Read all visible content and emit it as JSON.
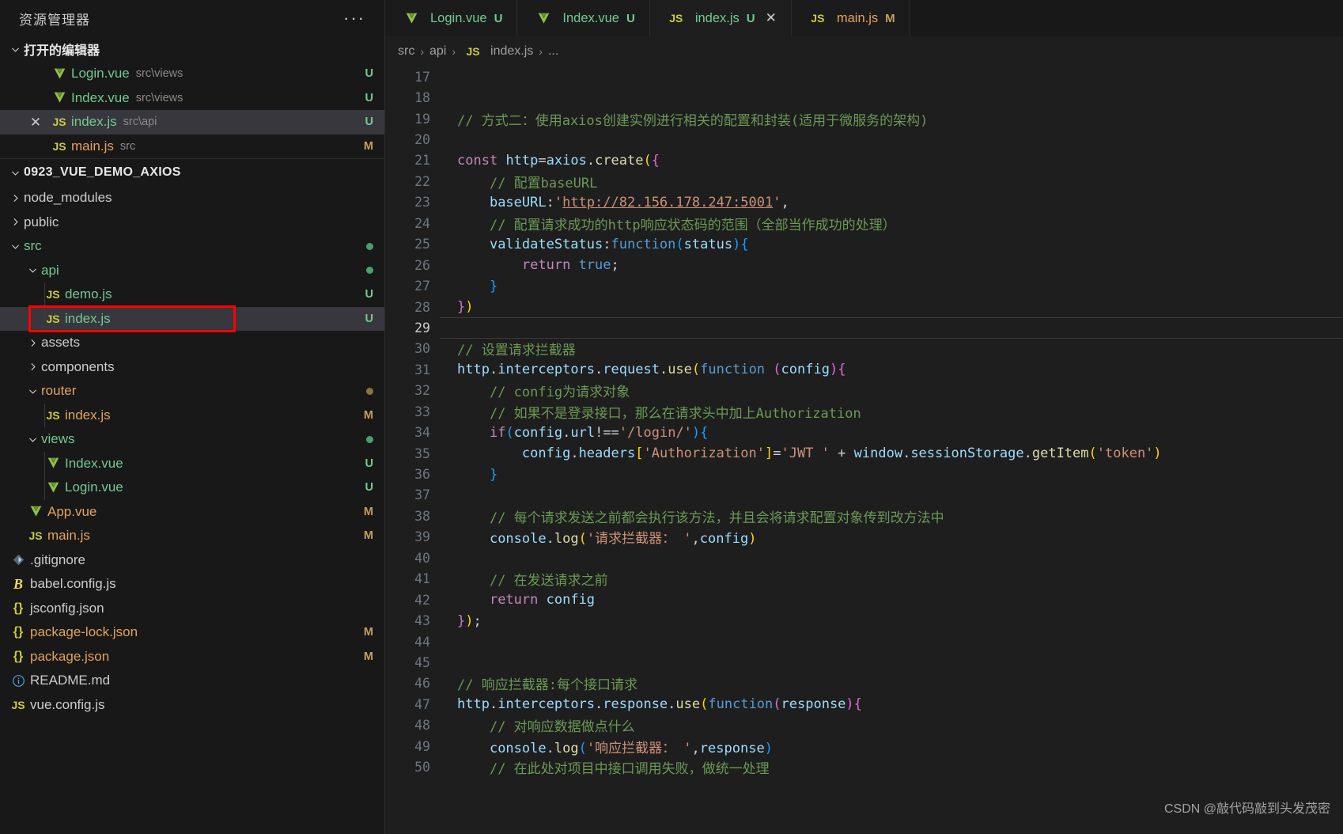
{
  "sidebar": {
    "title": "资源管理器",
    "more_label": "···",
    "open_editors": {
      "label": "打开的编辑器",
      "items": [
        {
          "icon": "vue-icon",
          "name": "Login.vue",
          "desc": "src\\views",
          "badge": "U",
          "badge_kind": "U",
          "selected": false,
          "has_close": false,
          "color": "green"
        },
        {
          "icon": "vue-icon",
          "name": "Index.vue",
          "desc": "src\\views",
          "badge": "U",
          "badge_kind": "U",
          "selected": false,
          "has_close": false,
          "color": "green"
        },
        {
          "icon": "js-icon",
          "name": "index.js",
          "desc": "src\\api",
          "badge": "U",
          "badge_kind": "U",
          "selected": true,
          "has_close": true,
          "color": "green"
        },
        {
          "icon": "js-icon",
          "name": "main.js",
          "desc": "src",
          "badge": "M",
          "badge_kind": "M",
          "selected": false,
          "has_close": false,
          "color": "orange"
        }
      ]
    },
    "project": {
      "name": "0923_VUE_DEMO_AXIOS",
      "tree": [
        {
          "indent": 1,
          "kind": "folder",
          "twisty": "right",
          "name": "node_modules",
          "color": "plain"
        },
        {
          "indent": 1,
          "kind": "folder",
          "twisty": "right",
          "name": "public",
          "color": "plain"
        },
        {
          "indent": 1,
          "kind": "folder",
          "twisty": "down",
          "name": "src",
          "color": "green",
          "dot": "U"
        },
        {
          "indent": 2,
          "kind": "folder",
          "twisty": "down",
          "name": "api",
          "color": "green",
          "dot": "U"
        },
        {
          "indent": 3,
          "kind": "file",
          "icon": "js-icon",
          "name": "demo.js",
          "color": "green",
          "badge": "U",
          "badge_kind": "U"
        },
        {
          "indent": 3,
          "kind": "file",
          "icon": "js-icon",
          "name": "index.js",
          "color": "green",
          "badge": "U",
          "badge_kind": "U",
          "selected": true,
          "boxed": true
        },
        {
          "indent": 2,
          "kind": "folder",
          "twisty": "right",
          "name": "assets",
          "color": "plain"
        },
        {
          "indent": 2,
          "kind": "folder",
          "twisty": "right",
          "name": "components",
          "color": "plain"
        },
        {
          "indent": 2,
          "kind": "folder",
          "twisty": "down",
          "name": "router",
          "color": "orange",
          "dot": "M"
        },
        {
          "indent": 3,
          "kind": "file",
          "icon": "js-icon",
          "name": "index.js",
          "color": "orange",
          "badge": "M",
          "badge_kind": "M"
        },
        {
          "indent": 2,
          "kind": "folder",
          "twisty": "down",
          "name": "views",
          "color": "green",
          "dot": "U"
        },
        {
          "indent": 3,
          "kind": "file",
          "icon": "vue-icon",
          "name": "Index.vue",
          "color": "green",
          "badge": "U",
          "badge_kind": "U"
        },
        {
          "indent": 3,
          "kind": "file",
          "icon": "vue-icon",
          "name": "Login.vue",
          "color": "green",
          "badge": "U",
          "badge_kind": "U"
        },
        {
          "indent": 2,
          "kind": "file",
          "icon": "vue-icon",
          "name": "App.vue",
          "color": "orange",
          "badge": "M",
          "badge_kind": "M"
        },
        {
          "indent": 2,
          "kind": "file",
          "icon": "js-icon",
          "name": "main.js",
          "color": "orange",
          "badge": "M",
          "badge_kind": "M"
        },
        {
          "indent": 1,
          "kind": "file",
          "icon": "git-icon",
          "name": ".gitignore",
          "color": "plain"
        },
        {
          "indent": 1,
          "kind": "file",
          "icon": "babel-icon",
          "name": "babel.config.js",
          "color": "plain"
        },
        {
          "indent": 1,
          "kind": "file",
          "icon": "json-icon",
          "name": "jsconfig.json",
          "color": "plain"
        },
        {
          "indent": 1,
          "kind": "file",
          "icon": "json-icon",
          "name": "package-lock.json",
          "color": "orange",
          "badge": "M",
          "badge_kind": "M"
        },
        {
          "indent": 1,
          "kind": "file",
          "icon": "json-icon",
          "name": "package.json",
          "color": "orange",
          "badge": "M",
          "badge_kind": "M"
        },
        {
          "indent": 1,
          "kind": "file",
          "icon": "md-icon",
          "name": "README.md",
          "color": "plain"
        },
        {
          "indent": 1,
          "kind": "file",
          "icon": "js-icon",
          "name": "vue.config.js",
          "color": "plain"
        }
      ]
    }
  },
  "editor": {
    "tabs": [
      {
        "icon": "vue-icon",
        "name": "Login.vue",
        "badge": "U",
        "badge_kind": "U",
        "active": false,
        "has_close": false,
        "color": "green"
      },
      {
        "icon": "vue-icon",
        "name": "Index.vue",
        "badge": "U",
        "badge_kind": "U",
        "active": false,
        "has_close": false,
        "color": "green"
      },
      {
        "icon": "js-icon",
        "name": "index.js",
        "badge": "U",
        "badge_kind": "U",
        "active": true,
        "has_close": true,
        "color": "green"
      },
      {
        "icon": "js-icon",
        "name": "main.js",
        "badge": "M",
        "badge_kind": "M",
        "active": false,
        "has_close": false,
        "color": "orange"
      }
    ],
    "breadcrumb": [
      {
        "label": "src",
        "icon": null
      },
      {
        "label": "api",
        "icon": null
      },
      {
        "label": "index.js",
        "icon": "js-icon"
      },
      {
        "label": "...",
        "icon": null
      }
    ],
    "first_line_number": 17,
    "active_line_number": 29,
    "code_lines": [
      {
        "n": 17,
        "tokens": []
      },
      {
        "n": 18,
        "tokens": []
      },
      {
        "n": 19,
        "tokens": [
          {
            "t": "// 方式二：使用axios创建实例进行相关的配置和封装(适用于微服务的架构)",
            "c": "t-comment"
          }
        ]
      },
      {
        "n": 20,
        "tokens": []
      },
      {
        "n": 21,
        "tokens": [
          {
            "t": "const",
            "c": "t-keyword"
          },
          {
            "t": " ",
            "c": "t-plain"
          },
          {
            "t": "http",
            "c": "t-var"
          },
          {
            "t": "=",
            "c": "t-plain"
          },
          {
            "t": "axios",
            "c": "t-var"
          },
          {
            "t": ".",
            "c": "t-plain"
          },
          {
            "t": "create",
            "c": "t-func"
          },
          {
            "t": "(",
            "c": "t-p1"
          },
          {
            "t": "{",
            "c": "t-p2"
          }
        ]
      },
      {
        "n": 22,
        "tokens": [
          {
            "t": "    ",
            "c": "t-plain"
          },
          {
            "t": "// 配置baseURL",
            "c": "t-comment"
          }
        ]
      },
      {
        "n": 23,
        "tokens": [
          {
            "t": "    ",
            "c": "t-plain"
          },
          {
            "t": "baseURL",
            "c": "t-var"
          },
          {
            "t": ":",
            "c": "t-plain"
          },
          {
            "t": "'",
            "c": "t-string"
          },
          {
            "t": "http://82.156.178.247:5001",
            "c": "t-link"
          },
          {
            "t": "'",
            "c": "t-string"
          },
          {
            "t": ",",
            "c": "t-plain"
          }
        ]
      },
      {
        "n": 24,
        "tokens": [
          {
            "t": "    ",
            "c": "t-plain"
          },
          {
            "t": "// 配置请求成功的http响应状态码的范围（全部当作成功的处理）",
            "c": "t-comment"
          }
        ]
      },
      {
        "n": 25,
        "tokens": [
          {
            "t": "    ",
            "c": "t-plain"
          },
          {
            "t": "validateStatus",
            "c": "t-var"
          },
          {
            "t": ":",
            "c": "t-plain"
          },
          {
            "t": "function",
            "c": "t-blue"
          },
          {
            "t": "(",
            "c": "t-p3"
          },
          {
            "t": "status",
            "c": "t-var"
          },
          {
            "t": ")",
            "c": "t-p3"
          },
          {
            "t": "{",
            "c": "t-p3"
          }
        ]
      },
      {
        "n": 26,
        "tokens": [
          {
            "t": "        ",
            "c": "t-plain"
          },
          {
            "t": "return",
            "c": "t-keyword"
          },
          {
            "t": " ",
            "c": "t-plain"
          },
          {
            "t": "true",
            "c": "t-blue"
          },
          {
            "t": ";",
            "c": "t-plain"
          }
        ]
      },
      {
        "n": 27,
        "tokens": [
          {
            "t": "    ",
            "c": "t-plain"
          },
          {
            "t": "}",
            "c": "t-p3"
          }
        ]
      },
      {
        "n": 28,
        "tokens": [
          {
            "t": "}",
            "c": "t-p2"
          },
          {
            "t": ")",
            "c": "t-p1"
          }
        ]
      },
      {
        "n": 29,
        "tokens": [],
        "active": true
      },
      {
        "n": 30,
        "tokens": [
          {
            "t": "// 设置请求拦截器",
            "c": "t-comment"
          }
        ]
      },
      {
        "n": 31,
        "tokens": [
          {
            "t": "http",
            "c": "t-var"
          },
          {
            "t": ".",
            "c": "t-plain"
          },
          {
            "t": "interceptors",
            "c": "t-var"
          },
          {
            "t": ".",
            "c": "t-plain"
          },
          {
            "t": "request",
            "c": "t-var"
          },
          {
            "t": ".",
            "c": "t-plain"
          },
          {
            "t": "use",
            "c": "t-func"
          },
          {
            "t": "(",
            "c": "t-p1"
          },
          {
            "t": "function",
            "c": "t-blue"
          },
          {
            "t": " ",
            "c": "t-plain"
          },
          {
            "t": "(",
            "c": "t-p2"
          },
          {
            "t": "config",
            "c": "t-var"
          },
          {
            "t": ")",
            "c": "t-p2"
          },
          {
            "t": "{",
            "c": "t-p2"
          }
        ]
      },
      {
        "n": 32,
        "tokens": [
          {
            "t": "    ",
            "c": "t-plain"
          },
          {
            "t": "// config为请求对象",
            "c": "t-comment"
          }
        ]
      },
      {
        "n": 33,
        "tokens": [
          {
            "t": "    ",
            "c": "t-plain"
          },
          {
            "t": "// 如果不是登录接口，那么在请求头中加上Authorization",
            "c": "t-comment"
          }
        ]
      },
      {
        "n": 34,
        "tokens": [
          {
            "t": "    ",
            "c": "t-plain"
          },
          {
            "t": "if",
            "c": "t-ctrl"
          },
          {
            "t": "(",
            "c": "t-p3"
          },
          {
            "t": "config",
            "c": "t-var"
          },
          {
            "t": ".",
            "c": "t-plain"
          },
          {
            "t": "url",
            "c": "t-var"
          },
          {
            "t": "!==",
            "c": "t-plain"
          },
          {
            "t": "'/login/'",
            "c": "t-string"
          },
          {
            "t": ")",
            "c": "t-p3"
          },
          {
            "t": "{",
            "c": "t-p3"
          }
        ]
      },
      {
        "n": 35,
        "tokens": [
          {
            "t": "        ",
            "c": "t-plain"
          },
          {
            "t": "config",
            "c": "t-var"
          },
          {
            "t": ".",
            "c": "t-plain"
          },
          {
            "t": "headers",
            "c": "t-var"
          },
          {
            "t": "[",
            "c": "t-p1"
          },
          {
            "t": "'Authorization'",
            "c": "t-string"
          },
          {
            "t": "]",
            "c": "t-p1"
          },
          {
            "t": "=",
            "c": "t-plain"
          },
          {
            "t": "'JWT '",
            "c": "t-string"
          },
          {
            "t": " + ",
            "c": "t-plain"
          },
          {
            "t": "window",
            "c": "t-var"
          },
          {
            "t": ".",
            "c": "t-plain"
          },
          {
            "t": "sessionStorage",
            "c": "t-var"
          },
          {
            "t": ".",
            "c": "t-plain"
          },
          {
            "t": "getItem",
            "c": "t-func"
          },
          {
            "t": "(",
            "c": "t-p1"
          },
          {
            "t": "'token'",
            "c": "t-string"
          },
          {
            "t": ")",
            "c": "t-p1"
          }
        ]
      },
      {
        "n": 36,
        "tokens": [
          {
            "t": "    ",
            "c": "t-plain"
          },
          {
            "t": "}",
            "c": "t-p3"
          }
        ]
      },
      {
        "n": 37,
        "tokens": []
      },
      {
        "n": 38,
        "tokens": [
          {
            "t": "    ",
            "c": "t-plain"
          },
          {
            "t": "// 每个请求发送之前都会执行该方法，并且会将请求配置对象传到改方法中",
            "c": "t-comment"
          }
        ]
      },
      {
        "n": 39,
        "tokens": [
          {
            "t": "    ",
            "c": "t-plain"
          },
          {
            "t": "console",
            "c": "t-var"
          },
          {
            "t": ".",
            "c": "t-plain"
          },
          {
            "t": "log",
            "c": "t-func"
          },
          {
            "t": "(",
            "c": "t-p1"
          },
          {
            "t": "'请求拦截器： '",
            "c": "t-string"
          },
          {
            "t": ",",
            "c": "t-plain"
          },
          {
            "t": "config",
            "c": "t-var"
          },
          {
            "t": ")",
            "c": "t-p1"
          }
        ]
      },
      {
        "n": 40,
        "tokens": []
      },
      {
        "n": 41,
        "tokens": [
          {
            "t": "    ",
            "c": "t-plain"
          },
          {
            "t": "// 在发送请求之前",
            "c": "t-comment"
          }
        ]
      },
      {
        "n": 42,
        "tokens": [
          {
            "t": "    ",
            "c": "t-plain"
          },
          {
            "t": "return",
            "c": "t-keyword"
          },
          {
            "t": " ",
            "c": "t-plain"
          },
          {
            "t": "config",
            "c": "t-var"
          }
        ]
      },
      {
        "n": 43,
        "tokens": [
          {
            "t": "}",
            "c": "t-p2"
          },
          {
            "t": ")",
            "c": "t-p1"
          },
          {
            "t": ";",
            "c": "t-plain"
          }
        ]
      },
      {
        "n": 44,
        "tokens": []
      },
      {
        "n": 45,
        "tokens": []
      },
      {
        "n": 46,
        "tokens": [
          {
            "t": "// 响应拦截器:每个接口请求",
            "c": "t-comment"
          }
        ]
      },
      {
        "n": 47,
        "tokens": [
          {
            "t": "http",
            "c": "t-var"
          },
          {
            "t": ".",
            "c": "t-plain"
          },
          {
            "t": "interceptors",
            "c": "t-var"
          },
          {
            "t": ".",
            "c": "t-plain"
          },
          {
            "t": "response",
            "c": "t-var"
          },
          {
            "t": ".",
            "c": "t-plain"
          },
          {
            "t": "use",
            "c": "t-func"
          },
          {
            "t": "(",
            "c": "t-p1"
          },
          {
            "t": "function",
            "c": "t-blue"
          },
          {
            "t": "(",
            "c": "t-p2"
          },
          {
            "t": "response",
            "c": "t-var"
          },
          {
            "t": ")",
            "c": "t-p2"
          },
          {
            "t": "{",
            "c": "t-p2"
          }
        ]
      },
      {
        "n": 48,
        "tokens": [
          {
            "t": "    ",
            "c": "t-plain"
          },
          {
            "t": "// 对响应数据做点什么",
            "c": "t-comment"
          }
        ]
      },
      {
        "n": 49,
        "tokens": [
          {
            "t": "    ",
            "c": "t-plain"
          },
          {
            "t": "console",
            "c": "t-var"
          },
          {
            "t": ".",
            "c": "t-plain"
          },
          {
            "t": "log",
            "c": "t-func"
          },
          {
            "t": "(",
            "c": "t-p3"
          },
          {
            "t": "'响应拦截器： '",
            "c": "t-string"
          },
          {
            "t": ",",
            "c": "t-plain"
          },
          {
            "t": "response",
            "c": "t-var"
          },
          {
            "t": ")",
            "c": "t-p3"
          }
        ]
      },
      {
        "n": 50,
        "tokens": [
          {
            "t": "    ",
            "c": "t-plain"
          },
          {
            "t": "// 在此处对项目中接口调用失败，做统一处理",
            "c": "t-comment"
          }
        ]
      }
    ]
  },
  "watermark": "CSDN @敲代码敲到头发茂密",
  "colors": {
    "sidebar_bg": "#181818",
    "editor_bg": "#1e1e1e",
    "selected_row": "#37373d",
    "accent_green": "#73c991",
    "accent_orange": "#e2a25e",
    "annotation_red": "#ff0000"
  }
}
